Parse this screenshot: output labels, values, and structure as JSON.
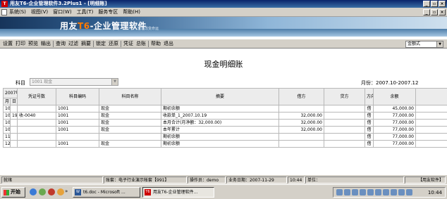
{
  "window": {
    "title": "用友T6-企业管理软件3.2Plus1  - [明细账]",
    "app_icon": "T"
  },
  "menubar": {
    "items": [
      "系统(S)",
      "视图(V)",
      "窗口(W)",
      "工具(T)",
      "服务专区",
      "帮助(H)"
    ]
  },
  "banner": {
    "logo_prefix": "用友",
    "logo_num": "T6",
    "logo_suffix": "-企业管理软件",
    "slogan": "管理改变命运"
  },
  "toolbar": {
    "items": [
      "设置",
      "打印",
      "预览",
      "输出",
      "查询",
      "过滤",
      "摘要",
      "锁定",
      "还原",
      "凭证",
      "总账",
      "帮助",
      "退出"
    ],
    "format_value": "金额式"
  },
  "report": {
    "title": "现金明细账",
    "subject_label": "科目",
    "subject_value": "1001 现金",
    "month_label": "月份：2007.10-2007.12"
  },
  "table": {
    "year_header": "2007年",
    "month_header": "月",
    "day_header": "日",
    "headers": [
      "凭证号数",
      "科目编码",
      "科目名称",
      "摘要",
      "借方",
      "贷方",
      "方向",
      "余额"
    ],
    "rows": [
      {
        "month": "10",
        "day": "",
        "voucher": "",
        "code": "1001",
        "name": "现金",
        "summary": "期初余额",
        "debit": "",
        "credit": "",
        "dir": "借",
        "balance": "45,000.00"
      },
      {
        "month": "10",
        "day": "19",
        "voucher": "收-0040",
        "code": "1001",
        "name": "现金",
        "summary": "收款单_1_2007.10.19",
        "debit": "32,000.00",
        "credit": "",
        "dir": "借",
        "balance": "77,000.00"
      },
      {
        "month": "10",
        "day": "",
        "voucher": "",
        "code": "1001",
        "name": "现金",
        "summary": "本月合计(月净额：32,000.00)",
        "debit": "32,000.00",
        "credit": "",
        "dir": "借",
        "balance": "77,000.00"
      },
      {
        "month": "10",
        "day": "",
        "voucher": "",
        "code": "1001",
        "name": "现金",
        "summary": "本年累计",
        "debit": "32,000.00",
        "credit": "",
        "dir": "借",
        "balance": "77,000.00"
      },
      {
        "month": "11",
        "day": "",
        "voucher": "",
        "code": "",
        "name": "",
        "summary": "期初余额",
        "debit": "",
        "credit": "",
        "dir": "借",
        "balance": "77,000.00"
      },
      {
        "month": "12",
        "day": "",
        "voucher": "",
        "code": "1001",
        "name": "现金",
        "summary": "期初余额",
        "debit": "",
        "credit": "",
        "dir": "借",
        "balance": "77,000.00"
      }
    ]
  },
  "statusbar": {
    "ready": "就绪",
    "account": "账套：电子行业演示帐套【991】",
    "operator": "操作员：demo",
    "date": "业务日期：2007-11-29",
    "time": "10:44",
    "unit": "单位：",
    "vendor": "【用友软件】"
  },
  "taskbar": {
    "start_label": "开始",
    "more": "»",
    "tasks": [
      "t6.doc - Microsoft ...",
      "用友T6-企业管理软件..."
    ],
    "clock": "10:44"
  }
}
